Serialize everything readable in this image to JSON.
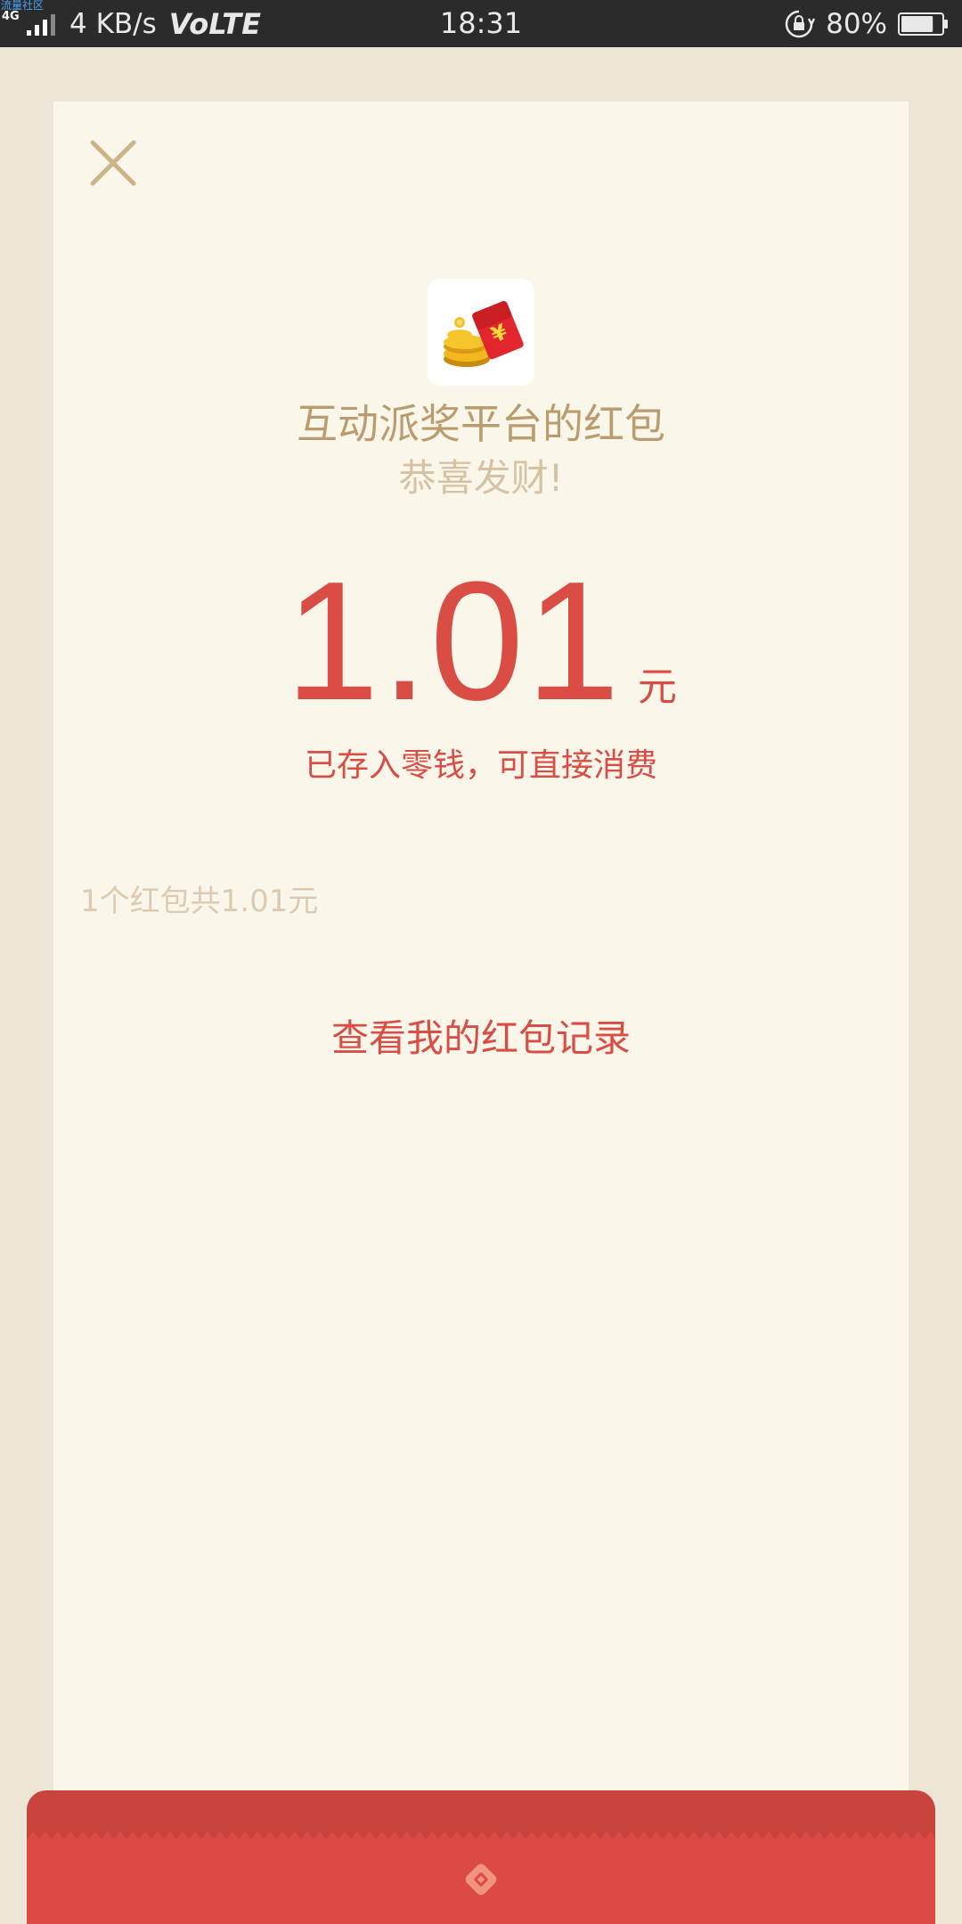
{
  "status_bar": {
    "watermark": "流量社区",
    "network_type": "4G",
    "speed": "4 KB/s",
    "volte": "VoLTE",
    "time": "18:31",
    "battery_percent": "80%",
    "battery_level": 0.8,
    "icons": [
      "signal-icon",
      "rotation-lock-icon",
      "battery-icon"
    ]
  },
  "red_packet": {
    "close_icon": "close-icon",
    "sender_logo_icon": "red-envelope-coins-icon",
    "title": "互动派奖平台的红包",
    "greeting": "恭喜发财!",
    "amount": "1.01",
    "unit": "元",
    "stored_notice": "已存入零钱，可直接消费",
    "summary": "1个红包共1.01元",
    "records_link": "查看我的红包记录"
  },
  "colors": {
    "accent_red": "#d94d45",
    "gold": "#b99d6f",
    "card_bg": "#fbf6ea",
    "page_bg": "#ede6d6"
  }
}
